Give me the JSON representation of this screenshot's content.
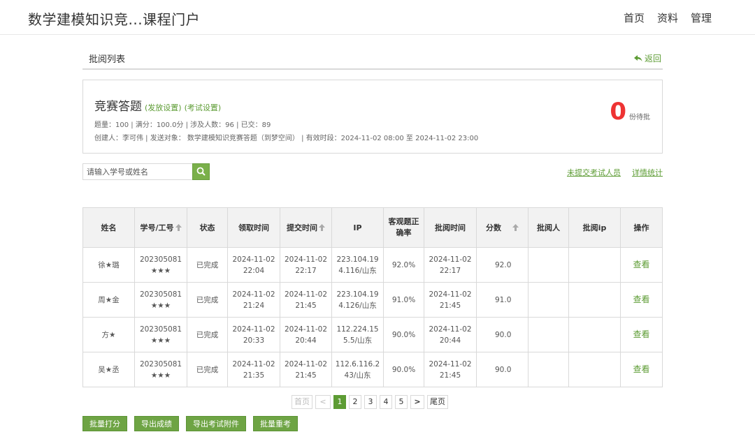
{
  "header": {
    "site_title": "数学建模知识竞...课程门户",
    "nav": [
      "首页",
      "资料",
      "管理"
    ]
  },
  "section": {
    "title": "批阅列表",
    "back_label": "返回"
  },
  "exam": {
    "name": "竞赛答题",
    "publish_settings": "(发放设置)",
    "exam_settings": "(考试设置)",
    "stats": "题量：100 | 满分：100.0分 | 涉及人数：96 | 已交：89",
    "meta": "创建人：李可伟 | 发送对象： 数学建模知识竞赛答题（到梦空间） | 有效时段：2024-11-02 08:00 至 2024-11-02 23:00",
    "pending_count": "0",
    "pending_label": "份待批"
  },
  "search": {
    "placeholder": "请输入学号或姓名"
  },
  "links": {
    "unsubmitted": "未提交考试人员",
    "details": "详情统计"
  },
  "table": {
    "headers": [
      "姓名",
      "学号/工号",
      "状态",
      "领取时间",
      "提交时间",
      "IP",
      "客观题正确率",
      "批阅时间",
      "分数",
      "批阅人",
      "批阅ip",
      "操作"
    ],
    "rows": [
      {
        "name": "徐★璐",
        "id": "202305081★★★",
        "status": "已完成",
        "get_date": "2024-11-02",
        "get_time": "22:04",
        "sub_date": "2024-11-02",
        "sub_time": "22:17",
        "ip": "223.104.194.116/山东",
        "rate": "92.0%",
        "review_date": "2024-11-02",
        "review_time": "22:17",
        "score": "92.0",
        "reviewer": "",
        "reviewer_ip": "",
        "action": "查看"
      },
      {
        "name": "周★金",
        "id": "202305081★★★",
        "status": "已完成",
        "get_date": "2024-11-02",
        "get_time": "21:24",
        "sub_date": "2024-11-02",
        "sub_time": "21:45",
        "ip": "223.104.194.126/山东",
        "rate": "91.0%",
        "review_date": "2024-11-02",
        "review_time": "21:45",
        "score": "91.0",
        "reviewer": "",
        "reviewer_ip": "",
        "action": "查看"
      },
      {
        "name": "方★",
        "id": "202305081★★★",
        "status": "已完成",
        "get_date": "2024-11-02",
        "get_time": "20:33",
        "sub_date": "2024-11-02",
        "sub_time": "20:44",
        "ip": "112.224.155.5/山东",
        "rate": "90.0%",
        "review_date": "2024-11-02",
        "review_time": "20:44",
        "score": "90.0",
        "reviewer": "",
        "reviewer_ip": "",
        "action": "查看"
      },
      {
        "name": "吴★丞",
        "id": "202305081★★★",
        "status": "已完成",
        "get_date": "2024-11-02",
        "get_time": "21:35",
        "sub_date": "2024-11-02",
        "sub_time": "21:45",
        "ip": "112.6.116.243/山东",
        "rate": "90.0%",
        "review_date": "2024-11-02",
        "review_time": "21:45",
        "score": "90.0",
        "reviewer": "",
        "reviewer_ip": "",
        "action": "查看"
      }
    ]
  },
  "pagination": {
    "first": "首页",
    "prev": "<",
    "pages": [
      "1",
      "2",
      "3",
      "4",
      "5"
    ],
    "next": ">",
    "last": "尾页",
    "current_page": "1"
  },
  "actions": [
    "批量打分",
    "导出成绩",
    "导出考试附件",
    "批量重考"
  ],
  "colors": {
    "accent_green": "#5d9c34",
    "button_green": "#6ea444",
    "pending_red": "#ee3333"
  }
}
